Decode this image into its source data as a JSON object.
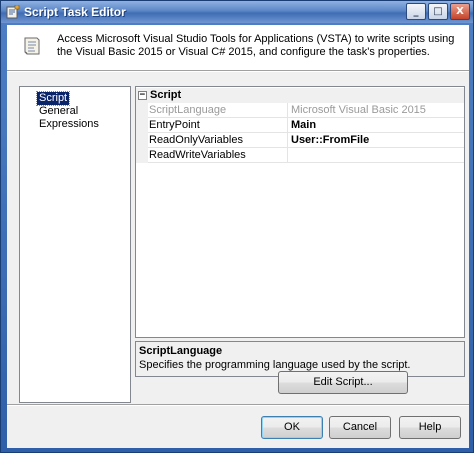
{
  "window": {
    "title": "Script Task Editor",
    "minimize_glyph": "_",
    "maximize_glyph": "□",
    "close_glyph": "X"
  },
  "header": {
    "description": "Access Microsoft Visual Studio Tools for Applications (VSTA) to write scripts using the Visual Basic 2015 or Visual C# 2015, and configure the task's properties."
  },
  "nav": {
    "items": [
      {
        "label": "Script",
        "selected": true
      },
      {
        "label": "General",
        "selected": false
      },
      {
        "label": "Expressions",
        "selected": false
      }
    ]
  },
  "properties": {
    "category": {
      "label": "Script",
      "toggle": "⊟"
    },
    "rows": [
      {
        "name": "ScriptLanguage",
        "value": "Microsoft Visual Basic 2015",
        "readonly": true
      },
      {
        "name": "EntryPoint",
        "value": "Main",
        "bold": true
      },
      {
        "name": "ReadOnlyVariables",
        "value": "User::FromFile",
        "bold": true
      },
      {
        "name": "ReadWriteVariables",
        "value": ""
      }
    ]
  },
  "description_panel": {
    "title": "ScriptLanguage",
    "text": "Specifies the programming language used by the script."
  },
  "buttons": {
    "edit_script": "Edit Script...",
    "ok": "OK",
    "cancel": "Cancel",
    "help": "Help"
  },
  "colors": {
    "title_bar": "#3f6cb4",
    "selection": "#0a246a",
    "dialog_bg": "#f0f0f0"
  }
}
